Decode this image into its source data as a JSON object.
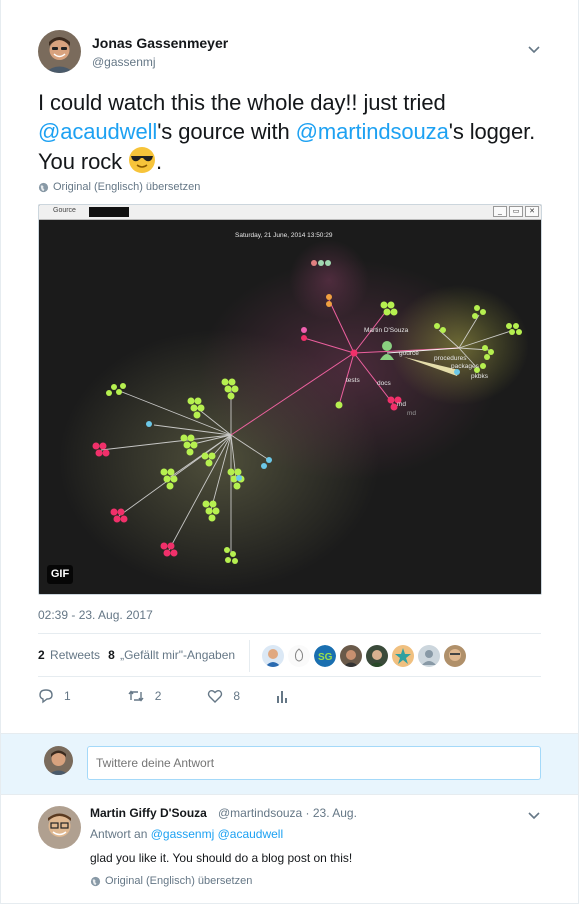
{
  "tweet": {
    "author_name": "Jonas Gassenmeyer",
    "author_handle": "@gassenmj",
    "text_parts": [
      "I could watch this the whole day!! just tried ",
      "@acaudwell",
      "'s gource with ",
      "@martindsouza",
      "'s logger. You rock ",
      "."
    ],
    "emoji": "sunglasses-emoji",
    "translate_label": "Original (Englisch) übersetzen",
    "timestamp": "02:39 - 23. Aug. 2017",
    "retweets_count": "2",
    "retweets_label": "Retweets",
    "likes_count": "8",
    "likes_label": "„Gefällt mir\"-Angaben",
    "actions": {
      "reply_count": "1",
      "retweet_count": "2",
      "like_count": "8"
    }
  },
  "media": {
    "window_title": "Gource",
    "window_buttons": [
      "_",
      "▭",
      "✕"
    ],
    "viz_date": "Saturday, 21 June, 2014 13:50:29",
    "viz_user": "Martin D'Souza",
    "viz_labels": {
      "gource": "gource",
      "tests": "tests",
      "docs": "docs",
      "md": "md",
      "md2": "md",
      "procedures": "procedures",
      "packages": "packages",
      "pkbks": "pkbks"
    },
    "badge": "GIF"
  },
  "composer": {
    "placeholder": "Twittere deine Antwort"
  },
  "reply": {
    "author_name": "Martin Giffy D'Souza",
    "author_handle_date": "@martindsouza · 23. Aug.",
    "reply_to_prefix": "Antwort an",
    "reply_to_handles": "@gassenmj @acaudwell",
    "text": "glad you like it. You should do a blog post on this!",
    "translate_label": "Original (Englisch) übersetzen"
  },
  "colors": {
    "link": "#1da1f2",
    "muted": "#657786",
    "composer_bg": "#e8f5fd"
  }
}
